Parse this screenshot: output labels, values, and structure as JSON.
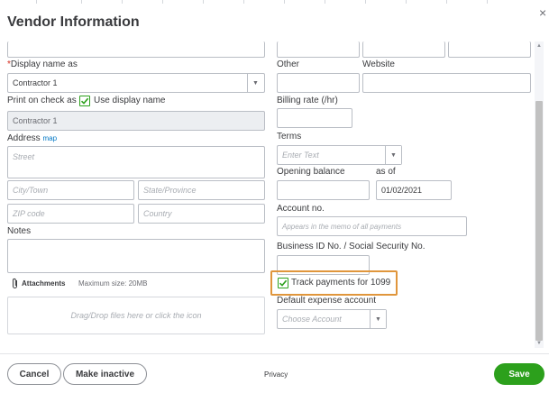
{
  "dialog": {
    "title": "Vendor Information",
    "close_glyph": "×"
  },
  "left": {
    "display_name_required_mark": "*",
    "display_name_label": "Display name as",
    "display_name_value": "Contractor 1",
    "print_on_check_label": "Print on check as",
    "use_display_name_label": "Use display name",
    "use_display_name_checked": true,
    "print_on_check_value": "Contractor 1",
    "address_label": "Address",
    "map_link": "map",
    "street_placeholder": "Street",
    "city_placeholder": "City/Town",
    "state_placeholder": "State/Province",
    "zip_placeholder": "ZIP code",
    "country_placeholder": "Country",
    "notes_label": "Notes",
    "attachments_label": "Attachments",
    "max_size_label": "Maximum size: 20MB",
    "dropzone_text": "Drag/Drop files here or click the icon"
  },
  "right": {
    "other_label": "Other",
    "website_label": "Website",
    "billing_rate_label": "Billing rate (/hr)",
    "terms_label": "Terms",
    "terms_placeholder": "Enter Text",
    "opening_balance_label": "Opening balance",
    "as_of_label": "as of",
    "as_of_value": "01/02/2021",
    "account_no_label": "Account no.",
    "account_no_placeholder": "Appears in the memo of all payments",
    "business_id_label": "Business ID No. / Social Security No.",
    "track_1099_label": "Track payments for 1099",
    "track_1099_checked": true,
    "default_expense_label": "Default expense account",
    "default_expense_placeholder": "Choose Account"
  },
  "footer": {
    "cancel_label": "Cancel",
    "make_inactive_label": "Make inactive",
    "privacy_label": "Privacy",
    "save_label": "Save"
  },
  "colors": {
    "accent_green": "#2ca01c",
    "highlight_orange": "#e0963c",
    "link_blue": "#0077c5",
    "required_red": "#d52b1e"
  },
  "icons": {
    "dropdown": "caret-down-icon",
    "check": "checkmark-icon",
    "attachment": "paperclip-icon",
    "close": "close-icon"
  }
}
